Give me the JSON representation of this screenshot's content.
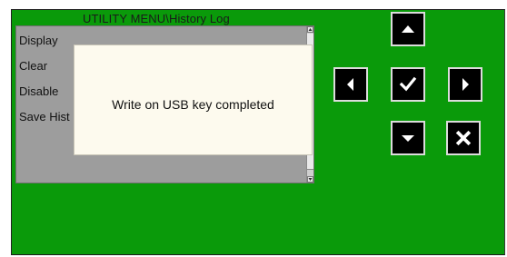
{
  "window": {
    "title": "UTILITY MENU\\History Log"
  },
  "menu": {
    "items": [
      {
        "label": "Display"
      },
      {
        "label": "Clear"
      },
      {
        "label": "Disable"
      },
      {
        "label": "Save Hist"
      }
    ]
  },
  "dialog": {
    "message": "Write on USB key completed"
  },
  "nav_buttons": [
    {
      "action": "up",
      "icon": "triangle-up-icon"
    },
    {
      "action": "left",
      "icon": "triangle-left-icon"
    },
    {
      "action": "ok",
      "icon": "checkmark-icon"
    },
    {
      "action": "right",
      "icon": "triangle-right-icon"
    },
    {
      "action": "down",
      "icon": "triangle-down-icon"
    },
    {
      "action": "cancel",
      "icon": "x-icon"
    }
  ],
  "colors": {
    "screen_background": "#0a9a0a",
    "menu_panel": "#9d9d9d",
    "dialog_background": "#fdfaee",
    "button_background": "#000000",
    "button_glyph": "#ffffff"
  }
}
